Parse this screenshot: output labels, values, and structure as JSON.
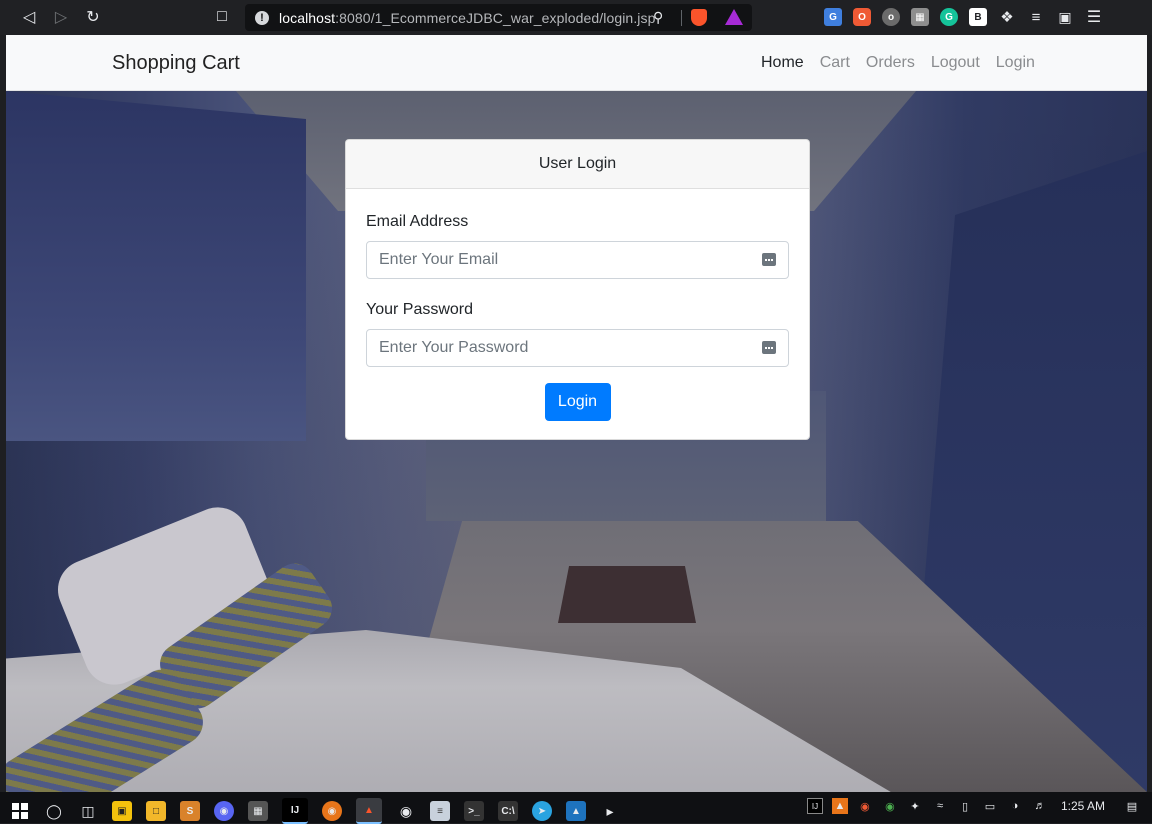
{
  "browser": {
    "url_host": "localhost",
    "url_rest": ":8080/1_EcommerceJDBC_war_exploded/login.jsp"
  },
  "navbar": {
    "brand": "Shopping Cart",
    "links": [
      {
        "label": "Home",
        "active": true
      },
      {
        "label": "Cart",
        "active": false
      },
      {
        "label": "Orders",
        "active": false
      },
      {
        "label": "Logout",
        "active": false
      },
      {
        "label": "Login",
        "active": false
      }
    ]
  },
  "login_card": {
    "header": "User Login",
    "email_label": "Email Address",
    "email_placeholder": "Enter Your Email",
    "email_value": "",
    "password_label": "Your Password",
    "password_placeholder": "Enter Your Password",
    "password_value": "",
    "submit_label": "Login",
    "accent_color": "#007bff"
  },
  "taskbar": {
    "clock": "1:25 AM"
  }
}
